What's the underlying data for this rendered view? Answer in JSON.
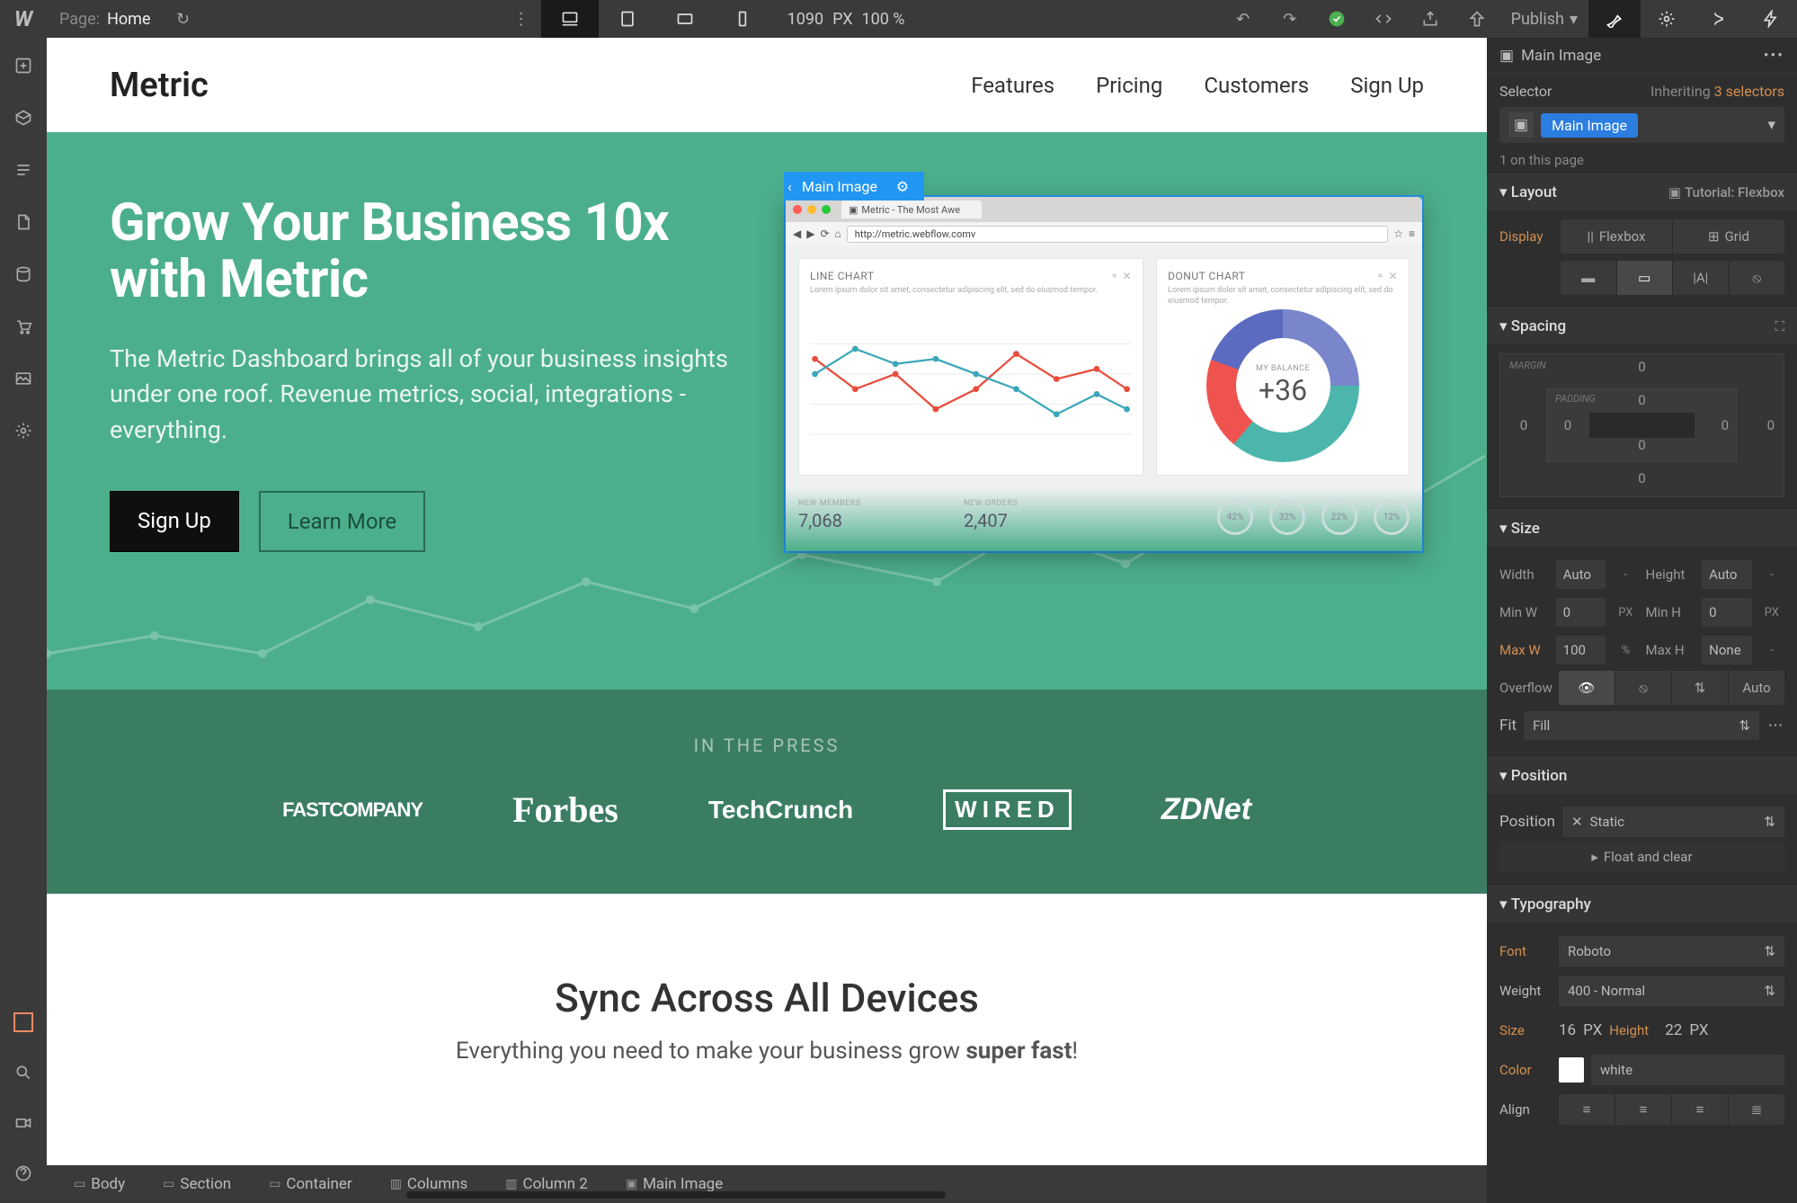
{
  "topbar": {
    "page_label": "Page:",
    "page_name": "Home",
    "px_value": "1090",
    "px_unit": "PX",
    "zoom": "100 %",
    "publish": "Publish"
  },
  "canvas_page": {
    "brand": "Metric",
    "nav": [
      "Features",
      "Pricing",
      "Customers",
      "Sign Up"
    ],
    "hero_title": "Grow Your Business 10x with Metric",
    "hero_sub": "The Metric Dashboard brings all of your business insights under one roof. Revenue metrics, social, integrations - everything.",
    "btn_primary": "Sign Up",
    "btn_secondary": "Learn More",
    "selection_label": "Main Image",
    "browser_tab": "Metric - The Most Awe",
    "browser_url": "http://metric.webflow.comv",
    "linechart_title": "LINE CHART",
    "donut_title": "DONUT CHART",
    "card_sub": "Lorem ipsum dolor sit amet, consectetur adipiscing elit, sed do eiusmod tempor.",
    "donut_label": "MY BALANCE",
    "donut_value": "+36",
    "metric1_label": "NEW MEMBERS",
    "metric1_value": "7,068",
    "metric2_label": "NEW ORDERS",
    "metric2_value": "2,407",
    "rings": [
      "42%",
      "32%",
      "22%",
      "12%"
    ],
    "press_label": "IN THE PRESS",
    "press_logos": [
      "FASTCOMPANY",
      "Forbes",
      "TechCrunch",
      "WIRED",
      "ZDNet"
    ],
    "sync_title": "Sync Across All Devices",
    "sync_sub_a": "Everything you need to make your business grow ",
    "sync_sub_b": "super fast",
    "sync_sub_c": "!"
  },
  "breadcrumbs": [
    "Body",
    "Section",
    "Container",
    "Columns",
    "Column 2",
    "Main Image"
  ],
  "panel": {
    "head": "Main Image",
    "selector_label": "Selector",
    "inheriting": "Inheriting",
    "inherit_count": "3 selectors",
    "chip": "Main Image",
    "count": "1 on this page",
    "layout": {
      "title": "Layout",
      "tutorial": "Tutorial: Flexbox",
      "display": "Display",
      "flexbox": "Flexbox",
      "grid": "Grid"
    },
    "spacing": {
      "title": "Spacing",
      "margin": "MARGIN",
      "padding": "PADDING",
      "m_top": "0",
      "m_right": "0",
      "m_bottom": "0",
      "m_left": "0",
      "p_top": "0",
      "p_right": "0",
      "p_bottom": "0",
      "p_left": "0"
    },
    "size": {
      "title": "Size",
      "width_l": "Width",
      "width_v": "Auto",
      "width_u": "-",
      "height_l": "Height",
      "height_v": "Auto",
      "height_u": "-",
      "minw_l": "Min W",
      "minw_v": "0",
      "minw_u": "PX",
      "minh_l": "Min H",
      "minh_v": "0",
      "minh_u": "PX",
      "maxw_l": "Max W",
      "maxw_v": "100",
      "maxw_u": "%",
      "maxh_l": "Max H",
      "maxh_v": "None",
      "maxh_u": "-",
      "overflow_l": "Overflow",
      "overflow_auto": "Auto",
      "fit_l": "Fit",
      "fit_v": "Fill"
    },
    "position": {
      "title": "Position",
      "label": "Position",
      "value": "Static",
      "float": "Float and clear"
    },
    "typography": {
      "title": "Typography",
      "font_l": "Font",
      "font_v": "Roboto",
      "weight_l": "Weight",
      "weight_v": "400 - Normal",
      "size_l": "Size",
      "size_v": "16",
      "size_u": "PX",
      "lh_l": "Height",
      "lh_v": "22",
      "lh_u": "PX",
      "color_l": "Color",
      "color_v": "white",
      "align_l": "Align"
    }
  }
}
